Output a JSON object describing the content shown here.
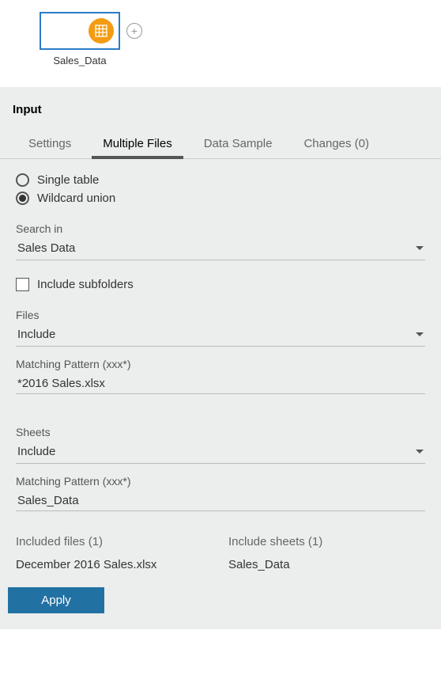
{
  "canvas": {
    "node_label": "Sales_Data"
  },
  "panel": {
    "title": "Input",
    "tabs": {
      "settings": "Settings",
      "multiple_files": "Multiple Files",
      "data_sample": "Data Sample",
      "changes": "Changes (0)"
    },
    "radio": {
      "single_table": "Single table",
      "wildcard_union": "Wildcard union"
    },
    "search_in": {
      "label": "Search in",
      "value": "Sales Data"
    },
    "include_subfolders": "Include subfolders",
    "files": {
      "label": "Files",
      "value": "Include"
    },
    "files_pattern": {
      "label": "Matching Pattern (xxx*)",
      "value": "*2016 Sales.xlsx"
    },
    "sheets": {
      "label": "Sheets",
      "value": "Include"
    },
    "sheets_pattern": {
      "label": "Matching Pattern (xxx*)",
      "value": "Sales_Data"
    },
    "results": {
      "files_header": "Included files (1)",
      "files_item": "December 2016 Sales.xlsx",
      "sheets_header": "Include sheets (1)",
      "sheets_item": "Sales_Data"
    },
    "apply": "Apply"
  }
}
